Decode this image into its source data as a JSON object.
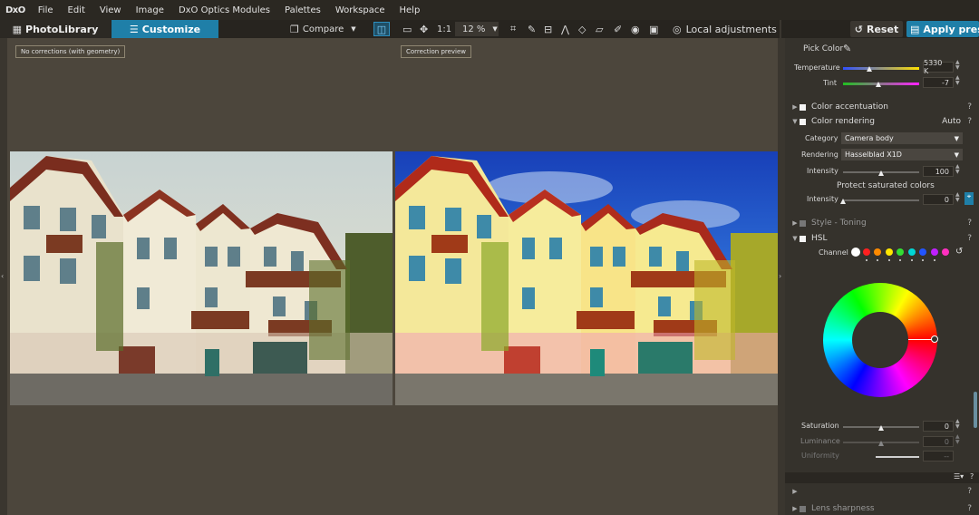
{
  "app": {
    "logo": "DxO"
  },
  "menu": [
    "File",
    "Edit",
    "View",
    "Image",
    "DxO Optics Modules",
    "Palettes",
    "Workspace",
    "Help"
  ],
  "tabs": {
    "photolibrary": "PhotoLibrary",
    "customize": "Customize"
  },
  "toolbar": {
    "compare": "Compare",
    "one_to_one": "1:1",
    "zoom": "12 %",
    "local_adjustments": "Local adjustments"
  },
  "header": {
    "reset": "Reset",
    "apply_preset": "Apply preset"
  },
  "viewer": {
    "left_label": "No corrections (with geometry)",
    "right_label": "Correction preview"
  },
  "panel": {
    "pick_color": "Pick Color",
    "temperature": {
      "label": "Temperature",
      "value": "5330 K",
      "level": 0.35
    },
    "tint": {
      "label": "Tint",
      "value": "-7",
      "level": 0.47
    },
    "color_accentuation": "Color accentuation",
    "color_rendering": {
      "label": "Color rendering",
      "mode": "Auto"
    },
    "category": {
      "label": "Category",
      "value": "Camera body"
    },
    "rendering": {
      "label": "Rendering",
      "value": "Hasselblad X1D"
    },
    "intensity": {
      "label": "Intensity",
      "value": "100",
      "level": 0.5
    },
    "protect_saturated": "Protect saturated colors",
    "protect_intensity": {
      "label": "Intensity",
      "value": "0",
      "level": 0.0
    },
    "style_toning": "Style - Toning",
    "hsl": "HSL",
    "channel": "Channel",
    "saturation": {
      "label": "Saturation",
      "value": "0",
      "level": 0.5
    },
    "luminance": {
      "label": "Luminance",
      "value": "0",
      "level": 0.5
    },
    "uniformity": {
      "label": "Uniformity",
      "value": "--"
    },
    "lens_sharpness": "Lens sharpness",
    "help": "?"
  },
  "colors": {
    "accent": "#1f7fa8",
    "channel_dots": [
      "#ffffff",
      "#ff2020",
      "#ff8a00",
      "#ffe600",
      "#33dd33",
      "#00d6d6",
      "#2255ff",
      "#c020ff",
      "#ff30c0"
    ]
  }
}
